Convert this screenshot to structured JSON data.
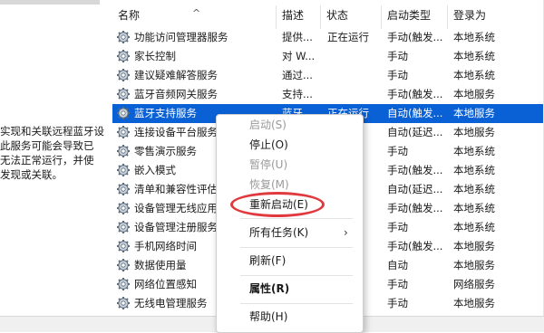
{
  "left_pane": {
    "description_lines": [
      "实现和关联远程蓝牙设",
      "此服务可能会导致已",
      "无法正常运行，并使",
      "发现或关联。"
    ]
  },
  "header": {
    "name": "名称",
    "desc": "描述",
    "status": "状态",
    "startup_type": "启动类型",
    "logon_as": "登录为"
  },
  "services": [
    {
      "name": "功能访问管理器服务",
      "desc": "提供...",
      "status": "正在运行",
      "type": "手动(触发...",
      "logon": "本地系统"
    },
    {
      "name": "家长控制",
      "desc": "对 W...",
      "status": "",
      "type": "手动",
      "logon": "本地系统"
    },
    {
      "name": "建议疑难解答服务",
      "desc": "通过...",
      "status": "",
      "type": "手动",
      "logon": "本地系统"
    },
    {
      "name": "蓝牙音频网关服务",
      "desc": "支持...",
      "status": "",
      "type": "手动(触发...",
      "logon": "本地服务"
    },
    {
      "name": "蓝牙支持服务",
      "desc": "蓝牙...",
      "status": "正在运行",
      "type": "自动(触发...",
      "logon": "本地服务"
    },
    {
      "name": "连接设备平台服务",
      "desc": "",
      "status": "行",
      "type": "自动(延迟...",
      "logon": "本地服务"
    },
    {
      "name": "零售演示服务",
      "desc": "",
      "status": "",
      "type": "手动",
      "logon": "本地系统"
    },
    {
      "name": "嵌入模式",
      "desc": "",
      "status": "",
      "type": "手动(触发...",
      "logon": "本地系统"
    },
    {
      "name": "清单和兼容性评估",
      "desc": "",
      "status": "行",
      "type": "自动(延迟...",
      "logon": "本地系统"
    },
    {
      "name": "设备管理无线应用",
      "desc": "",
      "status": "",
      "type": "手动(触发...",
      "logon": "本地系统"
    },
    {
      "name": "设备管理注册服务",
      "desc": "",
      "status": "",
      "type": "手动",
      "logon": "本地系统"
    },
    {
      "name": "手机网络时间",
      "desc": "",
      "status": "",
      "type": "手动(触发...",
      "logon": "本地服务"
    },
    {
      "name": "数据使用量",
      "desc": "",
      "status": "行",
      "type": "自动",
      "logon": "本地服务"
    },
    {
      "name": "网络位置感知",
      "desc": "",
      "status": "行",
      "type": "手动",
      "logon": "网络服务"
    },
    {
      "name": "无线电管理服务",
      "desc": "",
      "status": "行",
      "type": "手动",
      "logon": "本地服务"
    }
  ],
  "context_menu": {
    "start": "启动(S)",
    "stop": "停止(O)",
    "pause": "暂停(U)",
    "resume": "恢复(M)",
    "restart": "重新启动(E)",
    "all_tasks": "所有任务(K)",
    "refresh": "刷新(F)",
    "properties": "属性(R)",
    "help": "帮助(H)"
  },
  "colors": {
    "selection": "#0a61d6",
    "highlight_ellipse": "#e0393e"
  }
}
